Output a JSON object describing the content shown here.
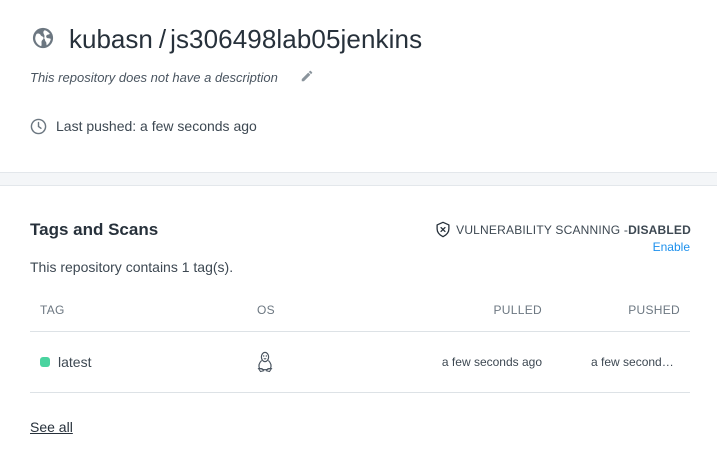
{
  "repo": {
    "namespace": "kubasn",
    "separator": "/",
    "name": "js306498lab05jenkins",
    "description": "This repository does not have a description",
    "last_pushed": "Last pushed: a few seconds ago"
  },
  "tags_section": {
    "title": "Tags and Scans",
    "scanning_label": "VULNERABILITY SCANNING - ",
    "scanning_status": "DISABLED",
    "enable_link": "Enable",
    "summary": "This repository contains 1 tag(s).",
    "columns": [
      "TAG",
      "OS",
      "PULLED",
      "PUSHED"
    ],
    "rows": [
      {
        "tag": "latest",
        "os_icon": "linux-icon",
        "pulled": "a few seconds ago",
        "pushed": "a few seconds ago"
      }
    ],
    "see_all": "See all"
  },
  "colors": {
    "link": "#1c90ed",
    "tag_dot": "#4ad39f",
    "divider_band": "#f4f6f8"
  },
  "icons": {
    "repo_icon": "globe-icon",
    "edit_icon": "pencil-icon",
    "time_icon": "clock-icon",
    "scan_icon": "shield-x-icon"
  }
}
